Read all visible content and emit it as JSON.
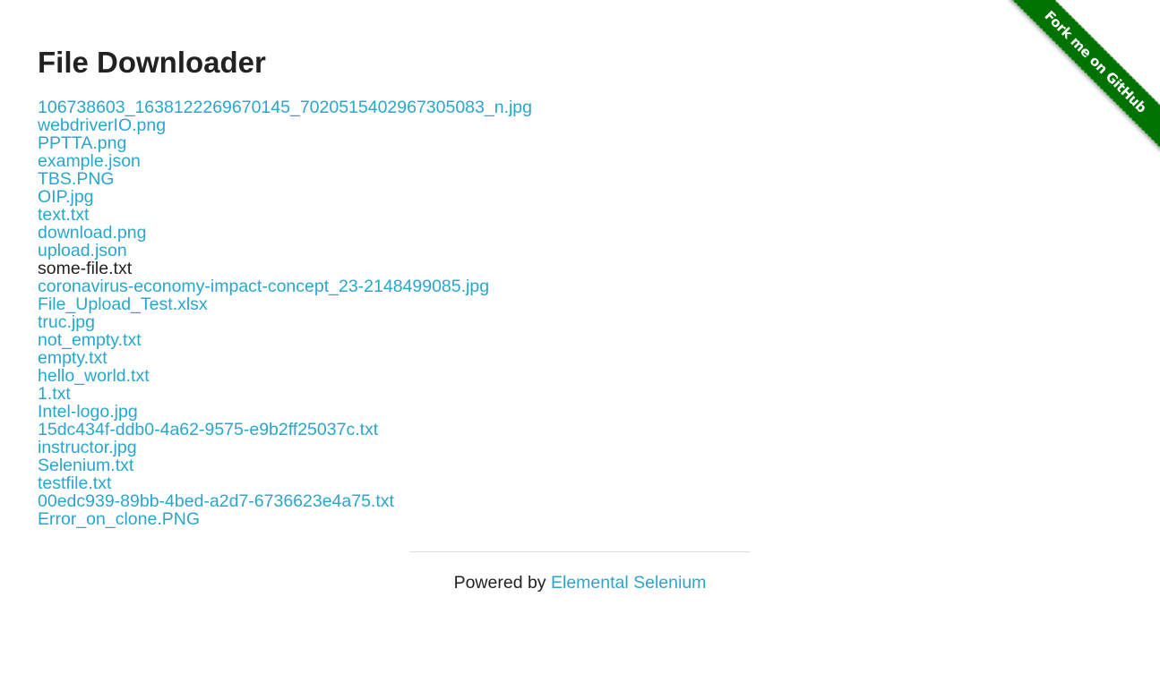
{
  "page": {
    "title": "File Downloader"
  },
  "files": [
    "106738603_1638122269670145_7020515402967305083_n.jpg",
    "webdriverIO.png",
    "PPTTA.png",
    "example.json",
    "TBS.PNG",
    "OIP.jpg",
    "text.txt",
    "download.png",
    "upload.json",
    "some-file.txt",
    "coronavirus-economy-impact-concept_23-2148499085.jpg",
    "File_Upload_Test.xlsx",
    "truc.jpg",
    "not_empty.txt",
    "empty.txt",
    "hello_world.txt",
    "1.txt",
    "Intel-logo.jpg",
    "15dc434f-ddb0-4a62-9575-e9b2ff25037c.txt",
    "instructor.jpg",
    "Selenium.txt",
    "testfile.txt",
    "00edc939-89bb-4bed-a2d7-6736623e4a75.txt",
    "Error_on_clone.PNG"
  ],
  "hovered_file_index": 9,
  "footer": {
    "prefix": "Powered by ",
    "link_label": "Elemental Selenium"
  },
  "ribbon": {
    "label": "Fork me on GitHub"
  },
  "colors": {
    "link": "#2ba6cb",
    "text": "#222222",
    "ribbon": "#007200",
    "background": "#ffffff"
  }
}
